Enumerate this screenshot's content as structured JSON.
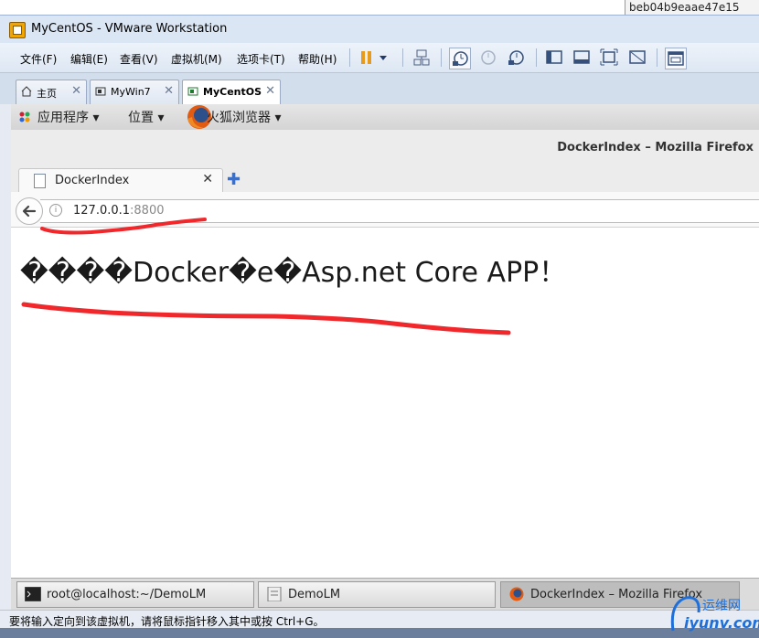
{
  "topright": {
    "text": "beb04b9eaae47e15"
  },
  "window": {
    "title": "MyCentOS - VMware Workstation"
  },
  "menu": [
    {
      "label": "文件(F)"
    },
    {
      "label": "编辑(E)"
    },
    {
      "label": "查看(V)"
    },
    {
      "label": "虚拟机(M)"
    },
    {
      "label": "选项卡(T)"
    },
    {
      "label": "帮助(H)"
    }
  ],
  "toolbar_icons": [
    "pause-icon",
    "dropdown-icon",
    "network-icon",
    "snapshot-icon",
    "revert-snapshot-icon",
    "snapshot-manager-icon",
    "console-view-icon",
    "fullscreen-icon",
    "unity-icon",
    "stretch-icon",
    "library-icon"
  ],
  "vm_tabs": [
    {
      "label": "主页",
      "icon": "home-icon"
    },
    {
      "label": "MyWin7",
      "icon": "vm-icon"
    },
    {
      "label": "MyCentOS",
      "icon": "vm-icon",
      "active": true
    }
  ],
  "gnome_panel": {
    "applications": "应用程序",
    "places": "位置",
    "firefox": "火狐浏览器"
  },
  "firefox": {
    "window_title": "DockerIndex – Mozilla Firefox",
    "tab_label": "DockerIndex",
    "url_host": "127.0.0.1",
    "url_port": ":8800"
  },
  "page": {
    "heading": "����Docker�e�Asp.net Core APP！"
  },
  "taskbar": [
    {
      "label": "root@localhost:~/DemoLM",
      "icon": "terminal-icon"
    },
    {
      "label": "DemoLM",
      "icon": "file-manager-icon"
    },
    {
      "label": "DockerIndex – Mozilla Firefox",
      "icon": "firefox-icon",
      "active": true
    }
  ],
  "statusbar": {
    "text": "要将输入定向到该虚拟机，请将鼠标指针移入其中或按 Ctrl+G。"
  },
  "watermark": {
    "line1": "运维网",
    "line2": "iyunv.com"
  },
  "colors": {
    "annotation": "#f0282c",
    "accent": "#1e6fd9"
  }
}
